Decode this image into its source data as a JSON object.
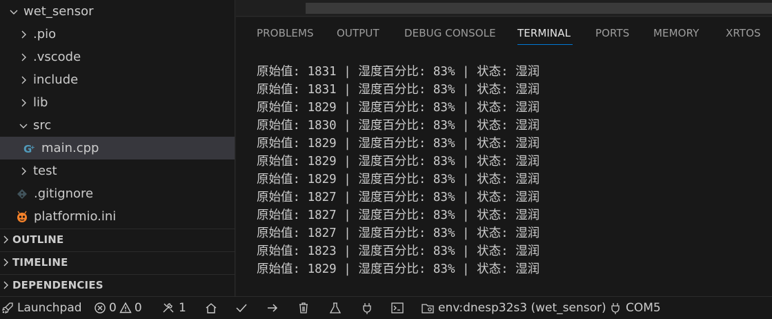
{
  "explorer": {
    "root_label": "wet_sensor",
    "items": [
      {
        "label": ".pio"
      },
      {
        "label": ".vscode"
      },
      {
        "label": "include"
      },
      {
        "label": "lib"
      },
      {
        "label": "src"
      },
      {
        "label": "main.cpp"
      },
      {
        "label": "test"
      },
      {
        "label": ".gitignore"
      },
      {
        "label": "platformio.ini"
      }
    ]
  },
  "sections": {
    "outline": "OUTLINE",
    "timeline": "TIMELINE",
    "dependencies": "DEPENDENCIES"
  },
  "panel": {
    "tabs": [
      "PROBLEMS",
      "OUTPUT",
      "DEBUG CONSOLE",
      "TERMINAL",
      "PORTS",
      "MEMORY",
      "XRTOS"
    ],
    "active_tab": "TERMINAL"
  },
  "terminal": {
    "lines": [
      "原始值: 1831 | 湿度百分比: 83% | 状态: 湿润",
      "原始值: 1831 | 湿度百分比: 83% | 状态: 湿润",
      "原始值: 1829 | 湿度百分比: 83% | 状态: 湿润",
      "原始值: 1830 | 湿度百分比: 83% | 状态: 湿润",
      "原始值: 1829 | 湿度百分比: 83% | 状态: 湿润",
      "原始值: 1829 | 湿度百分比: 83% | 状态: 湿润",
      "原始值: 1829 | 湿度百分比: 83% | 状态: 湿润",
      "原始值: 1827 | 湿度百分比: 83% | 状态: 湿润",
      "原始值: 1827 | 湿度百分比: 83% | 状态: 湿润",
      "原始值: 1827 | 湿度百分比: 83% | 状态: 湿润",
      "原始值: 1823 | 湿度百分比: 83% | 状态: 湿润",
      "原始值: 1829 | 湿度百分比: 83% | 状态: 湿润"
    ]
  },
  "statusbar": {
    "launchpad": "Launchpad",
    "errors": "0",
    "warnings": "0",
    "ports_count": "1",
    "env": "env:dnesp32s3 (wet_sensor)",
    "port": "COM5"
  },
  "colors": {
    "background": "#1f1f1f",
    "sidebar": "#181818",
    "selection": "#37373d",
    "accent": "#0078d4",
    "cpp_icon": "#519aba",
    "platformio_icon": "#f5822a"
  }
}
